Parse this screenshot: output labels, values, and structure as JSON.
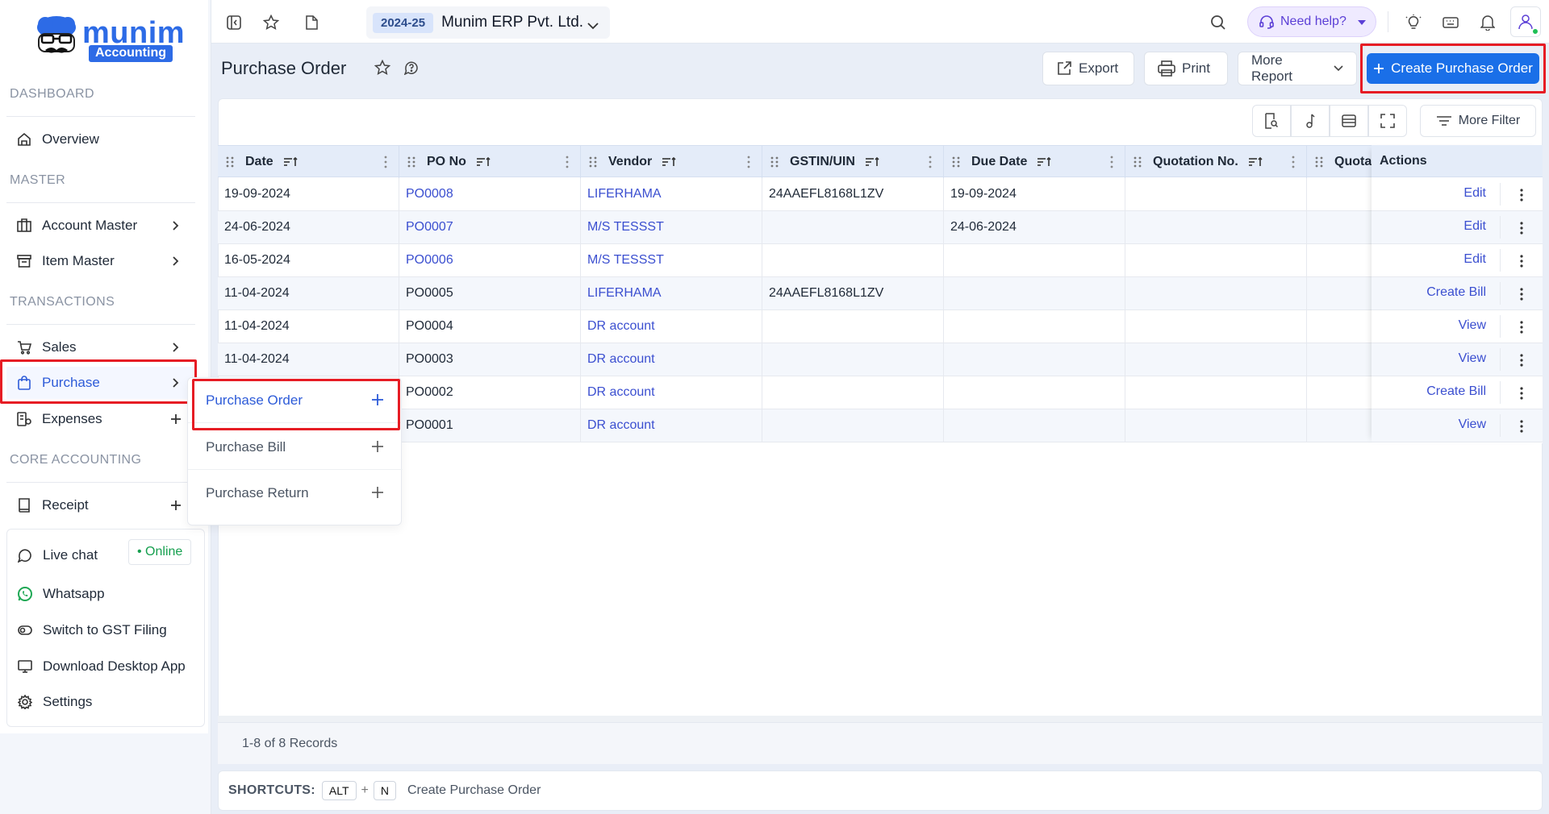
{
  "logo": {
    "brand": "munim",
    "tag": "Accounting"
  },
  "sidebar": {
    "sections": {
      "dashboard": "DASHBOARD",
      "master": "MASTER",
      "transactions": "TRANSACTIONS",
      "core": "CORE ACCOUNTING"
    },
    "items": {
      "overview": "Overview",
      "account_master": "Account Master",
      "item_master": "Item Master",
      "sales": "Sales",
      "purchase": "Purchase",
      "expenses": "Expenses",
      "receipt": "Receipt"
    },
    "bottom": {
      "live_chat": "Live chat",
      "online": "• Online",
      "whatsapp": "Whatsapp",
      "gst": "Switch to GST Filing",
      "download": "Download Desktop App",
      "settings": "Settings"
    }
  },
  "flyout": {
    "purchase_order": "Purchase Order",
    "purchase_bill": "Purchase Bill",
    "purchase_return": "Purchase Return"
  },
  "topbar": {
    "year": "2024-25",
    "company": "Munim ERP Pvt. Ltd.",
    "help": "Need help?"
  },
  "page": {
    "title": "Purchase Order",
    "export": "Export",
    "print": "Print",
    "more_report": "More Report",
    "create": "Create Purchase Order",
    "more_filter": "More Filter"
  },
  "table": {
    "columns": [
      "Date",
      "PO No",
      "Vendor",
      "GSTIN/UIN",
      "Due Date",
      "Quotation No.",
      "Quotat"
    ],
    "actions_header": "Actions",
    "rows": [
      {
        "date": "19-09-2024",
        "po": "PO0008",
        "po_link": true,
        "vendor": "LIFERHAMA",
        "gstin": "24AAEFL8168L1ZV",
        "due": "19-09-2024",
        "action": "Edit"
      },
      {
        "date": "24-06-2024",
        "po": "PO0007",
        "po_link": true,
        "vendor": "M/S TESSST",
        "gstin": "",
        "due": "24-06-2024",
        "action": "Edit"
      },
      {
        "date": "16-05-2024",
        "po": "PO0006",
        "po_link": true,
        "vendor": "M/S TESSST",
        "gstin": "",
        "due": "",
        "action": "Edit"
      },
      {
        "date": "11-04-2024",
        "po": "PO0005",
        "po_link": false,
        "vendor": "LIFERHAMA",
        "gstin": "24AAEFL8168L1ZV",
        "due": "",
        "action": "Create Bill"
      },
      {
        "date": "11-04-2024",
        "po": "PO0004",
        "po_link": false,
        "vendor": "DR account",
        "gstin": "",
        "due": "",
        "action": "View"
      },
      {
        "date": "11-04-2024",
        "po": "PO0003",
        "po_link": false,
        "vendor": "DR account",
        "gstin": "",
        "due": "",
        "action": "View"
      },
      {
        "date": "",
        "po": "PO0002",
        "po_link": false,
        "vendor": "DR account",
        "gstin": "",
        "due": "",
        "action": "Create Bill"
      },
      {
        "date": "",
        "po": "PO0001",
        "po_link": false,
        "vendor": "DR account",
        "gstin": "",
        "due": "",
        "action": "View"
      }
    ]
  },
  "footer": {
    "records": "1-8 of 8 Records",
    "shortcuts_label": "SHORTCUTS:",
    "key1": "ALT",
    "plus": "+",
    "key2": "N",
    "shortcut_desc": "Create Purchase Order"
  }
}
